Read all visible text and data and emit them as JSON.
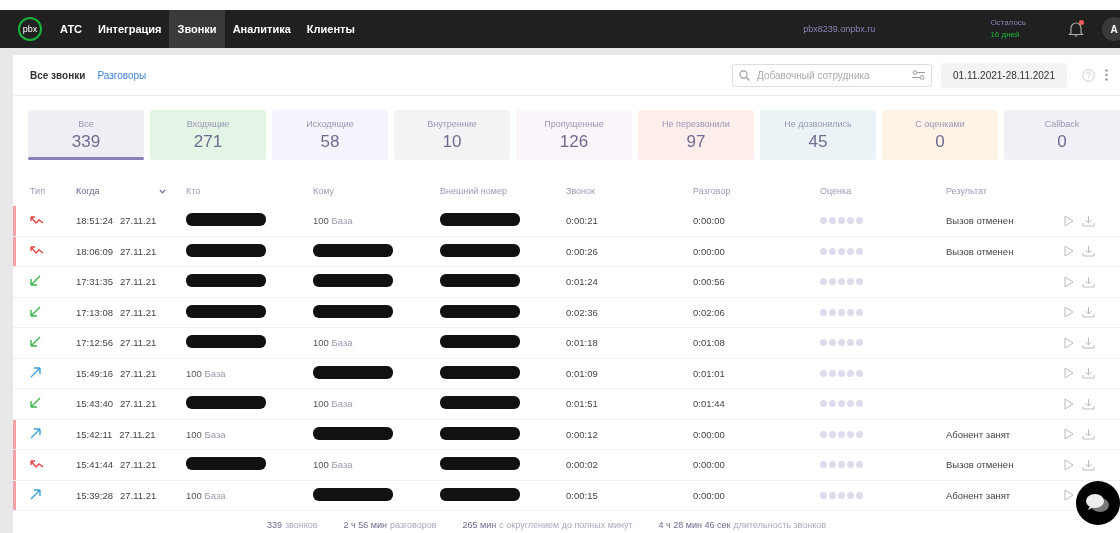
{
  "nav": {
    "logo": "pbx",
    "items": [
      {
        "label": "АТС",
        "selected": false
      },
      {
        "label": "Интеграция",
        "selected": false
      },
      {
        "label": "Звонки",
        "selected": true
      },
      {
        "label": "Аналитика",
        "selected": false
      },
      {
        "label": "Клиенты",
        "selected": false
      }
    ],
    "domain": "pbx8239.onpbx.ru",
    "remaining_label": "Осталось",
    "remaining_value": "16 дней",
    "notification": true,
    "avatar": "A"
  },
  "subtabs": [
    {
      "label": "Все звонки",
      "selected": true
    },
    {
      "label": "Разговоры",
      "selected": false
    }
  ],
  "search": {
    "placeholder": "Добавочный сотрудника"
  },
  "date_range": "01.11.2021-28.11.2021",
  "stats": [
    {
      "label": "Все",
      "value": "339",
      "color": "#efeef5",
      "selected": true
    },
    {
      "label": "Входящие",
      "value": "271",
      "color": "#e4f5e6",
      "selected": false
    },
    {
      "label": "Исходящие",
      "value": "58",
      "color": "#f4f4fd",
      "selected": false
    },
    {
      "label": "Внутренние",
      "value": "10",
      "color": "#f3f3f5",
      "selected": false
    },
    {
      "label": "Пропущенные",
      "value": "126",
      "color": "#fcf4fb",
      "selected": false
    },
    {
      "label": "Не перезвонили",
      "value": "97",
      "color": "#fdeeec",
      "selected": false
    },
    {
      "label": "Не дозвонились",
      "value": "45",
      "color": "#eaf3f6",
      "selected": false
    },
    {
      "label": "С оценками",
      "value": "0",
      "color": "#fef3e5",
      "selected": false
    },
    {
      "label": "Callback",
      "value": "0",
      "color": "#f1f0f6",
      "selected": false
    }
  ],
  "table": {
    "columns": [
      "Тип",
      "Когда",
      "Кто",
      "Кому",
      "Внешний номер",
      "Звонок",
      "Разговор",
      "Оценка",
      "Результат"
    ],
    "rows": [
      {
        "kind": "missed",
        "flagged": true,
        "time": "18:51:24",
        "date": "27.11.21",
        "who": {
          "kind": "redacted"
        },
        "to": {
          "kind": "ext",
          "number": "100",
          "name": "База"
        },
        "external": {
          "kind": "redacted"
        },
        "call": "0:00:21",
        "talk": "0:00:00",
        "stars": 0,
        "result": "Вызов отменен"
      },
      {
        "kind": "missed",
        "flagged": true,
        "time": "18:06:09",
        "date": "27.11.21",
        "who": {
          "kind": "redacted"
        },
        "to": {
          "kind": "redacted"
        },
        "external": {
          "kind": "redacted"
        },
        "call": "0:00:26",
        "talk": "0:00:00",
        "stars": 0,
        "result": "Вызов отменен"
      },
      {
        "kind": "incoming",
        "flagged": false,
        "time": "17:31:35",
        "date": "27.11.21",
        "who": {
          "kind": "redacted"
        },
        "to": {
          "kind": "redacted"
        },
        "external": {
          "kind": "redacted"
        },
        "call": "0:01:24",
        "talk": "0:00:56",
        "stars": 0
      },
      {
        "kind": "incoming",
        "flagged": false,
        "time": "17:13:08",
        "date": "27.11.21",
        "who": {
          "kind": "redacted"
        },
        "to": {
          "kind": "redacted"
        },
        "external": {
          "kind": "redacted"
        },
        "call": "0:02:36",
        "talk": "0:02:06",
        "stars": 0
      },
      {
        "kind": "incoming",
        "flagged": false,
        "time": "17:12:56",
        "date": "27.11.21",
        "who": {
          "kind": "redacted"
        },
        "to": {
          "kind": "ext",
          "number": "100",
          "name": "База"
        },
        "external": {
          "kind": "redacted"
        },
        "call": "0:01:18",
        "talk": "0:01:08",
        "stars": 0
      },
      {
        "kind": "outgoing",
        "flagged": false,
        "time": "15:49:16",
        "date": "27.11.21",
        "who": {
          "kind": "ext",
          "number": "100",
          "name": "База"
        },
        "to": {
          "kind": "redacted"
        },
        "external": {
          "kind": "redacted"
        },
        "call": "0:01:09",
        "talk": "0:01:01",
        "stars": 0
      },
      {
        "kind": "incoming",
        "flagged": false,
        "time": "15:43:40",
        "date": "27.11.21",
        "who": {
          "kind": "redacted"
        },
        "to": {
          "kind": "ext",
          "number": "100",
          "name": "База"
        },
        "external": {
          "kind": "redacted"
        },
        "call": "0:01:51",
        "talk": "0:01:44",
        "stars": 0
      },
      {
        "kind": "outgoing",
        "flagged": true,
        "time": "15:42:11",
        "date": "27.11.21",
        "who": {
          "kind": "ext",
          "number": "100",
          "name": "База"
        },
        "to": {
          "kind": "redacted"
        },
        "external": {
          "kind": "redacted"
        },
        "call": "0:00:12",
        "talk": "0:00:00",
        "stars": 0,
        "result": "Абонент занят"
      },
      {
        "kind": "missed",
        "flagged": true,
        "time": "15:41:44",
        "date": "27.11.21",
        "who": {
          "kind": "redacted"
        },
        "to": {
          "kind": "ext",
          "number": "100",
          "name": "База"
        },
        "external": {
          "kind": "redacted"
        },
        "call": "0:00:02",
        "talk": "0:00:00",
        "stars": 0,
        "result": "Вызов отменен"
      },
      {
        "kind": "outgoing",
        "flagged": true,
        "time": "15:39:28",
        "date": "27.11.21",
        "who": {
          "kind": "ext",
          "number": "100",
          "name": "База"
        },
        "to": {
          "kind": "redacted"
        },
        "external": {
          "kind": "redacted"
        },
        "call": "0:00:15",
        "talk": "0:00:00",
        "stars": 0,
        "result": "Абонент занят",
        "download": false
      }
    ]
  },
  "summary": [
    {
      "value": "339",
      "label": "звонков"
    },
    {
      "value": "2 ч 56 мин",
      "label": "разговоров"
    },
    {
      "value": "265 мин",
      "label": "с округлением до полных минут"
    },
    {
      "value": "4 ч 28 мин 46 сек",
      "label": "длительность звонков"
    }
  ]
}
